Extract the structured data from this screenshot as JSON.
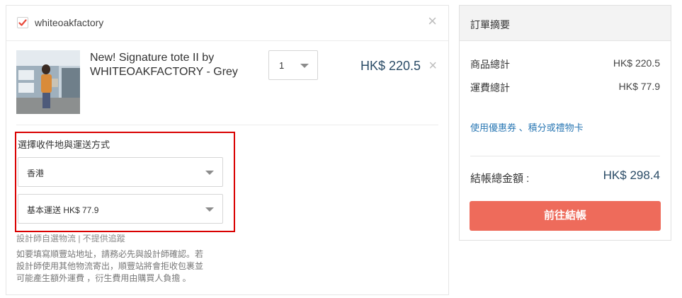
{
  "cart": {
    "shop_name": "whiteoakfactory",
    "product": {
      "title_line1": "New! Signature tote II by",
      "title_line2": "WHITEOAKFACTORY - Grey",
      "quantity": "1",
      "price": "HK$ 220.5"
    },
    "shipping": {
      "label": "選擇收件地與運送方式",
      "region": "香港",
      "method": "基本運送 HK$ 77.9"
    },
    "logistics_note": "設計師自選物流 | 不提供追蹤",
    "sf_note_lines": [
      "如要填寫順豐站地址，請務必先與設計師確認。若",
      "設計師使用其他物流寄出，順豐站將會拒收包裹並",
      "可能產生額外運費 ，衍生費用由購買人負擔 。"
    ]
  },
  "summary": {
    "title": "訂單摘要",
    "subtotal_label": "商品總計",
    "subtotal_value": "HK$ 220.5",
    "shipping_label": "運費總計",
    "shipping_value": "HK$ 77.9",
    "coupon_link": "使用優惠券 、積分或禮物卡",
    "total_label": "結帳總金額 :",
    "total_value": "HK$ 298.4",
    "checkout_button": "前往結帳"
  },
  "colors": {
    "accent_button": "#ee6b5b",
    "price_text": "#2a4b66",
    "link": "#2b78b4",
    "highlight_border": "#d90000"
  },
  "icons": [
    "checkmark-icon",
    "close-icon",
    "chevron-down-icon"
  ]
}
